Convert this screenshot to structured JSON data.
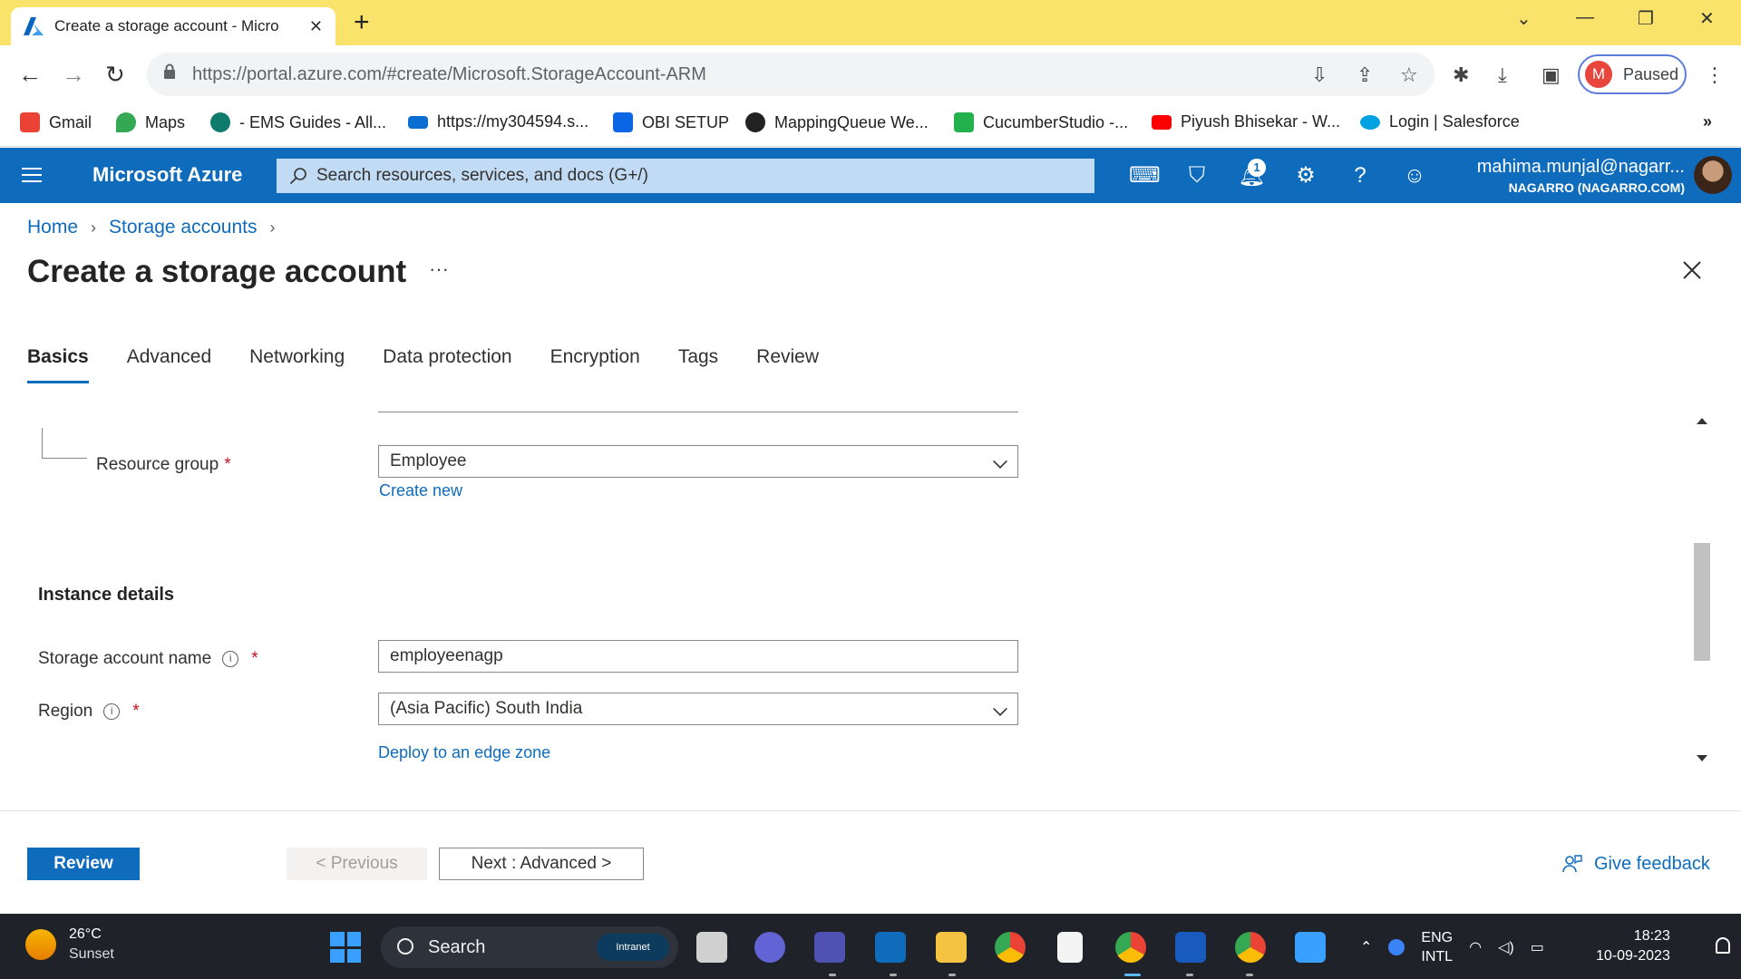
{
  "browser": {
    "tab_title": "Create a storage account - Micro",
    "url": "https://portal.azure.com/#create/Microsoft.StorageAccount-ARM",
    "profile_initial": "M",
    "profile_status": "Paused",
    "bookmarks": [
      {
        "label": "Gmail",
        "color": "#ea4335"
      },
      {
        "label": "Maps",
        "color": "#34a853"
      },
      {
        "label": "- EMS Guides - All...",
        "color": "#0f7b6c"
      },
      {
        "label": "https://my304594.s...",
        "color": "#0a6ed1"
      },
      {
        "label": "OBI SETUP",
        "color": "#0c66e4"
      },
      {
        "label": "MappingQueue We...",
        "color": "#222222"
      },
      {
        "label": "CucumberStudio -...",
        "color": "#23b14d"
      },
      {
        "label": "Piyush Bhisekar - W...",
        "color": "#ff0000"
      },
      {
        "label": "Login | Salesforce",
        "color": "#00a1e0"
      }
    ],
    "bookmarks_overflow": "»"
  },
  "azure": {
    "brand": "Microsoft Azure",
    "search_placeholder": "Search resources, services, and docs (G+/)",
    "notification_count": "1",
    "user_email": "mahima.munjal@nagarr...",
    "user_tenant": "NAGARRO (NAGARRO.COM)",
    "accent_color": "#0f6cbd"
  },
  "page": {
    "breadcrumb": [
      "Home",
      "Storage accounts"
    ],
    "title": "Create a storage account",
    "more": "···",
    "tabs": [
      "Basics",
      "Advanced",
      "Networking",
      "Data protection",
      "Encryption",
      "Tags",
      "Review"
    ],
    "active_tab": "Basics"
  },
  "form": {
    "resource_group_label": "Resource group",
    "resource_group_value": "Employee",
    "create_new": "Create new",
    "section_instance": "Instance details",
    "storage_name_label": "Storage account name",
    "storage_name_value": "employeenagp",
    "region_label": "Region",
    "region_value": "(Asia Pacific) South India",
    "edge_zone_link": "Deploy to an edge zone",
    "required_mark": "*",
    "info_glyph": "i"
  },
  "footer": {
    "review": "Review",
    "previous": "< Previous",
    "next": "Next : Advanced >",
    "feedback": "Give feedback"
  },
  "taskbar": {
    "temp": "26°C",
    "condition": "Sunset",
    "search": "Search",
    "intranet": "Intranet",
    "lang1": "ENG",
    "lang2": "INTL",
    "time": "18:23",
    "date": "10-09-2023"
  }
}
